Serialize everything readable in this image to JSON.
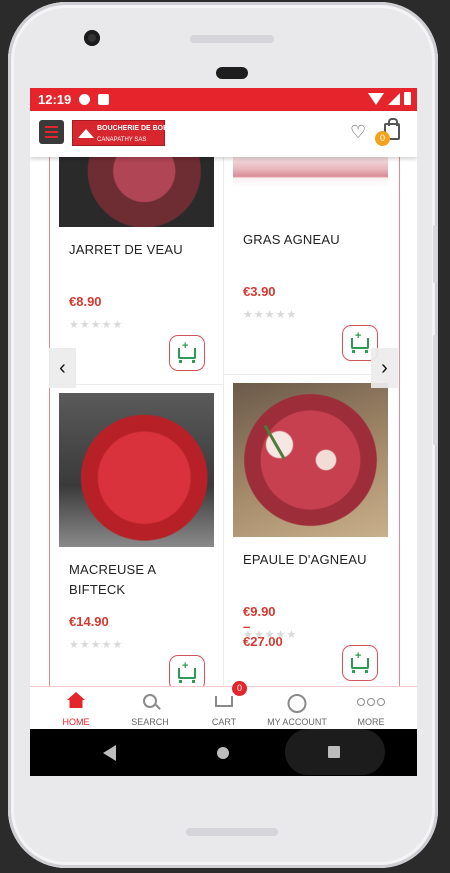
{
  "status_bar": {
    "time": "12:19"
  },
  "app_bar": {
    "logo_line1": "BOUCHERIE DE BOBIGNY",
    "logo_line2": "CANAPATHY SAS",
    "cart_count": "0"
  },
  "products": [
    {
      "name": "JARRET DE VEAU",
      "price": "€8.90",
      "rating": 0
    },
    {
      "name": "GRAS AGNEAU",
      "price": "€3.90",
      "rating": 0
    },
    {
      "name": "MACREUSE A BIFTECK",
      "price": "€14.90",
      "rating": 0
    },
    {
      "name": "EPAULE D'AGNEAU",
      "price": "€9.90 – €27.00",
      "rating": 0
    }
  ],
  "stars_text": "★★★★★",
  "bottom_nav": {
    "home": "HOME",
    "search": "SEARCH",
    "cart": "CART",
    "cart_badge": "0",
    "account": "MY ACCOUNT",
    "more": "MORE"
  },
  "colors": {
    "brand_red": "#e5242b",
    "price_red": "#d33a2f",
    "cart_green": "#2e9a55",
    "badge_orange": "#f3a21c"
  }
}
